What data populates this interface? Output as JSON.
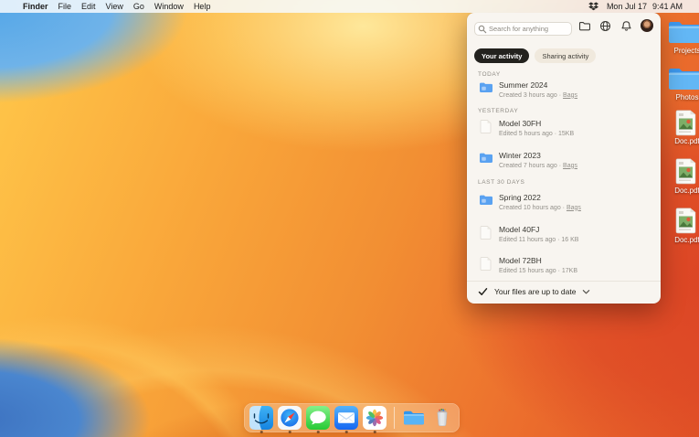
{
  "menu_bar": {
    "app_menu": "Finder",
    "menus": [
      "File",
      "Edit",
      "View",
      "Go",
      "Window",
      "Help"
    ],
    "tray_icon": "dropbox-icon",
    "date": "Mon Jul 17",
    "time": "9:41 AM"
  },
  "panel": {
    "search": {
      "placeholder": "Search for anything"
    },
    "header_icons": [
      "folder-icon",
      "globe-icon",
      "bell-icon",
      "avatar"
    ],
    "tabs": {
      "active": "Your activity",
      "inactive": "Sharing activity"
    },
    "section_headers": [
      "TODAY",
      "YESTERDAY",
      "LAST 30 DAYS"
    ],
    "items": [
      {
        "type": "folder",
        "title": "Summer 2024",
        "meta": "Created 3 hours ago · ",
        "link": "Bags"
      },
      {
        "type": "file",
        "title": "Model 30FH",
        "meta": "Edited 5 hours ago · 15KB"
      },
      {
        "type": "folder",
        "title": "Winter 2023",
        "meta": "Created 7 hours ago · ",
        "link": "Bags"
      },
      {
        "type": "folder",
        "title": "Spring 2022",
        "meta": "Created 10 hours ago · ",
        "link": "Bags"
      },
      {
        "type": "file",
        "title": "Model 40FJ",
        "meta": "Edited 11 hours ago · 16 KB"
      },
      {
        "type": "file",
        "title": "Model 72BH",
        "meta": "Edited 15 hours ago · 17KB"
      }
    ],
    "footer": {
      "status": "Your files are up to date"
    }
  },
  "desktop": {
    "icons": [
      {
        "label": "Projects",
        "type": "folder"
      },
      {
        "label": "Photos",
        "type": "folder"
      },
      {
        "label": "Doc.pdf",
        "type": "pdf"
      },
      {
        "label": "Doc.pdf",
        "type": "pdf"
      },
      {
        "label": "Doc.pdf",
        "type": "pdf"
      }
    ]
  },
  "dock": {
    "items": [
      "finder",
      "safari",
      "messages",
      "mail",
      "photos",
      "divider",
      "folder",
      "trash"
    ],
    "running": [
      "finder",
      "safari",
      "messages",
      "mail",
      "photos"
    ]
  },
  "colors": {
    "panel_bg": "#f8f5f0",
    "active_pill_bg": "#23221e",
    "active_pill_text": "#ffffff",
    "inactive_pill_bg": "#f0e9dd",
    "folder_blue": "#4f9ff0",
    "menubar_bg": "rgba(247,250,253,0.85)",
    "wallpaper_orange": "#f28f33",
    "wallpaper_blue": "#55a7e8"
  }
}
